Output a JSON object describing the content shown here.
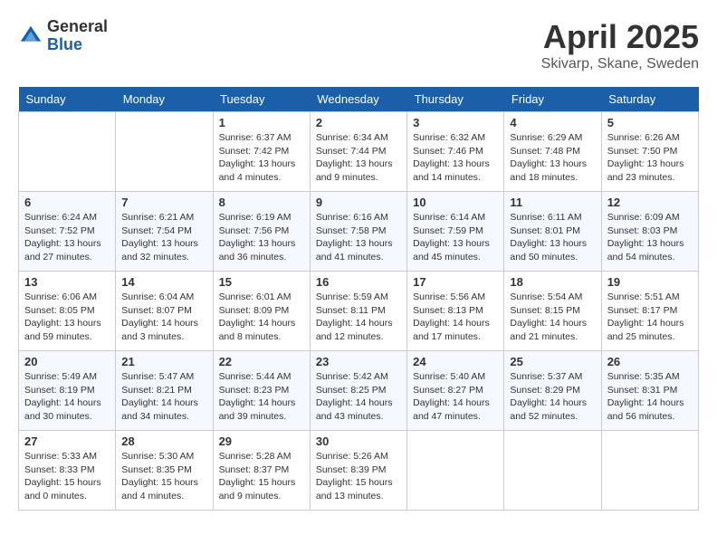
{
  "header": {
    "logo_general": "General",
    "logo_blue": "Blue",
    "month_title": "April 2025",
    "location": "Skivarp, Skane, Sweden"
  },
  "days_of_week": [
    "Sunday",
    "Monday",
    "Tuesday",
    "Wednesday",
    "Thursday",
    "Friday",
    "Saturday"
  ],
  "weeks": [
    [
      {
        "day": "",
        "info": ""
      },
      {
        "day": "",
        "info": ""
      },
      {
        "day": "1",
        "info": "Sunrise: 6:37 AM\nSunset: 7:42 PM\nDaylight: 13 hours and 4 minutes."
      },
      {
        "day": "2",
        "info": "Sunrise: 6:34 AM\nSunset: 7:44 PM\nDaylight: 13 hours and 9 minutes."
      },
      {
        "day": "3",
        "info": "Sunrise: 6:32 AM\nSunset: 7:46 PM\nDaylight: 13 hours and 14 minutes."
      },
      {
        "day": "4",
        "info": "Sunrise: 6:29 AM\nSunset: 7:48 PM\nDaylight: 13 hours and 18 minutes."
      },
      {
        "day": "5",
        "info": "Sunrise: 6:26 AM\nSunset: 7:50 PM\nDaylight: 13 hours and 23 minutes."
      }
    ],
    [
      {
        "day": "6",
        "info": "Sunrise: 6:24 AM\nSunset: 7:52 PM\nDaylight: 13 hours and 27 minutes."
      },
      {
        "day": "7",
        "info": "Sunrise: 6:21 AM\nSunset: 7:54 PM\nDaylight: 13 hours and 32 minutes."
      },
      {
        "day": "8",
        "info": "Sunrise: 6:19 AM\nSunset: 7:56 PM\nDaylight: 13 hours and 36 minutes."
      },
      {
        "day": "9",
        "info": "Sunrise: 6:16 AM\nSunset: 7:58 PM\nDaylight: 13 hours and 41 minutes."
      },
      {
        "day": "10",
        "info": "Sunrise: 6:14 AM\nSunset: 7:59 PM\nDaylight: 13 hours and 45 minutes."
      },
      {
        "day": "11",
        "info": "Sunrise: 6:11 AM\nSunset: 8:01 PM\nDaylight: 13 hours and 50 minutes."
      },
      {
        "day": "12",
        "info": "Sunrise: 6:09 AM\nSunset: 8:03 PM\nDaylight: 13 hours and 54 minutes."
      }
    ],
    [
      {
        "day": "13",
        "info": "Sunrise: 6:06 AM\nSunset: 8:05 PM\nDaylight: 13 hours and 59 minutes."
      },
      {
        "day": "14",
        "info": "Sunrise: 6:04 AM\nSunset: 8:07 PM\nDaylight: 14 hours and 3 minutes."
      },
      {
        "day": "15",
        "info": "Sunrise: 6:01 AM\nSunset: 8:09 PM\nDaylight: 14 hours and 8 minutes."
      },
      {
        "day": "16",
        "info": "Sunrise: 5:59 AM\nSunset: 8:11 PM\nDaylight: 14 hours and 12 minutes."
      },
      {
        "day": "17",
        "info": "Sunrise: 5:56 AM\nSunset: 8:13 PM\nDaylight: 14 hours and 17 minutes."
      },
      {
        "day": "18",
        "info": "Sunrise: 5:54 AM\nSunset: 8:15 PM\nDaylight: 14 hours and 21 minutes."
      },
      {
        "day": "19",
        "info": "Sunrise: 5:51 AM\nSunset: 8:17 PM\nDaylight: 14 hours and 25 minutes."
      }
    ],
    [
      {
        "day": "20",
        "info": "Sunrise: 5:49 AM\nSunset: 8:19 PM\nDaylight: 14 hours and 30 minutes."
      },
      {
        "day": "21",
        "info": "Sunrise: 5:47 AM\nSunset: 8:21 PM\nDaylight: 14 hours and 34 minutes."
      },
      {
        "day": "22",
        "info": "Sunrise: 5:44 AM\nSunset: 8:23 PM\nDaylight: 14 hours and 39 minutes."
      },
      {
        "day": "23",
        "info": "Sunrise: 5:42 AM\nSunset: 8:25 PM\nDaylight: 14 hours and 43 minutes."
      },
      {
        "day": "24",
        "info": "Sunrise: 5:40 AM\nSunset: 8:27 PM\nDaylight: 14 hours and 47 minutes."
      },
      {
        "day": "25",
        "info": "Sunrise: 5:37 AM\nSunset: 8:29 PM\nDaylight: 14 hours and 52 minutes."
      },
      {
        "day": "26",
        "info": "Sunrise: 5:35 AM\nSunset: 8:31 PM\nDaylight: 14 hours and 56 minutes."
      }
    ],
    [
      {
        "day": "27",
        "info": "Sunrise: 5:33 AM\nSunset: 8:33 PM\nDaylight: 15 hours and 0 minutes."
      },
      {
        "day": "28",
        "info": "Sunrise: 5:30 AM\nSunset: 8:35 PM\nDaylight: 15 hours and 4 minutes."
      },
      {
        "day": "29",
        "info": "Sunrise: 5:28 AM\nSunset: 8:37 PM\nDaylight: 15 hours and 9 minutes."
      },
      {
        "day": "30",
        "info": "Sunrise: 5:26 AM\nSunset: 8:39 PM\nDaylight: 15 hours and 13 minutes."
      },
      {
        "day": "",
        "info": ""
      },
      {
        "day": "",
        "info": ""
      },
      {
        "day": "",
        "info": ""
      }
    ]
  ]
}
